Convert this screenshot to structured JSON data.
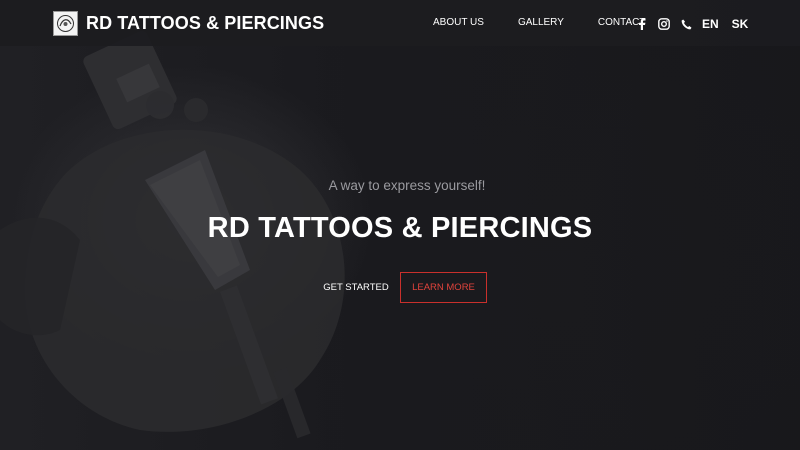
{
  "brand": {
    "name": "RD TATTOOS & PIERCINGS",
    "logo_text": "RD TATTOOS PIERCINGS"
  },
  "nav": {
    "links": [
      "ABOUT US",
      "GALLERY",
      "CONTACT"
    ],
    "icons": [
      "facebook-icon",
      "instagram-icon",
      "phone-icon"
    ],
    "languages": [
      "EN",
      "SK"
    ]
  },
  "hero": {
    "tagline": "A way to express yourself!",
    "title": "RD TATTOOS & PIERCINGS",
    "primary_button": "GET STARTED",
    "secondary_button": "LEARN MORE"
  },
  "colors": {
    "background": "#17171a",
    "accent": "#c9302c",
    "text": "#ffffff"
  }
}
